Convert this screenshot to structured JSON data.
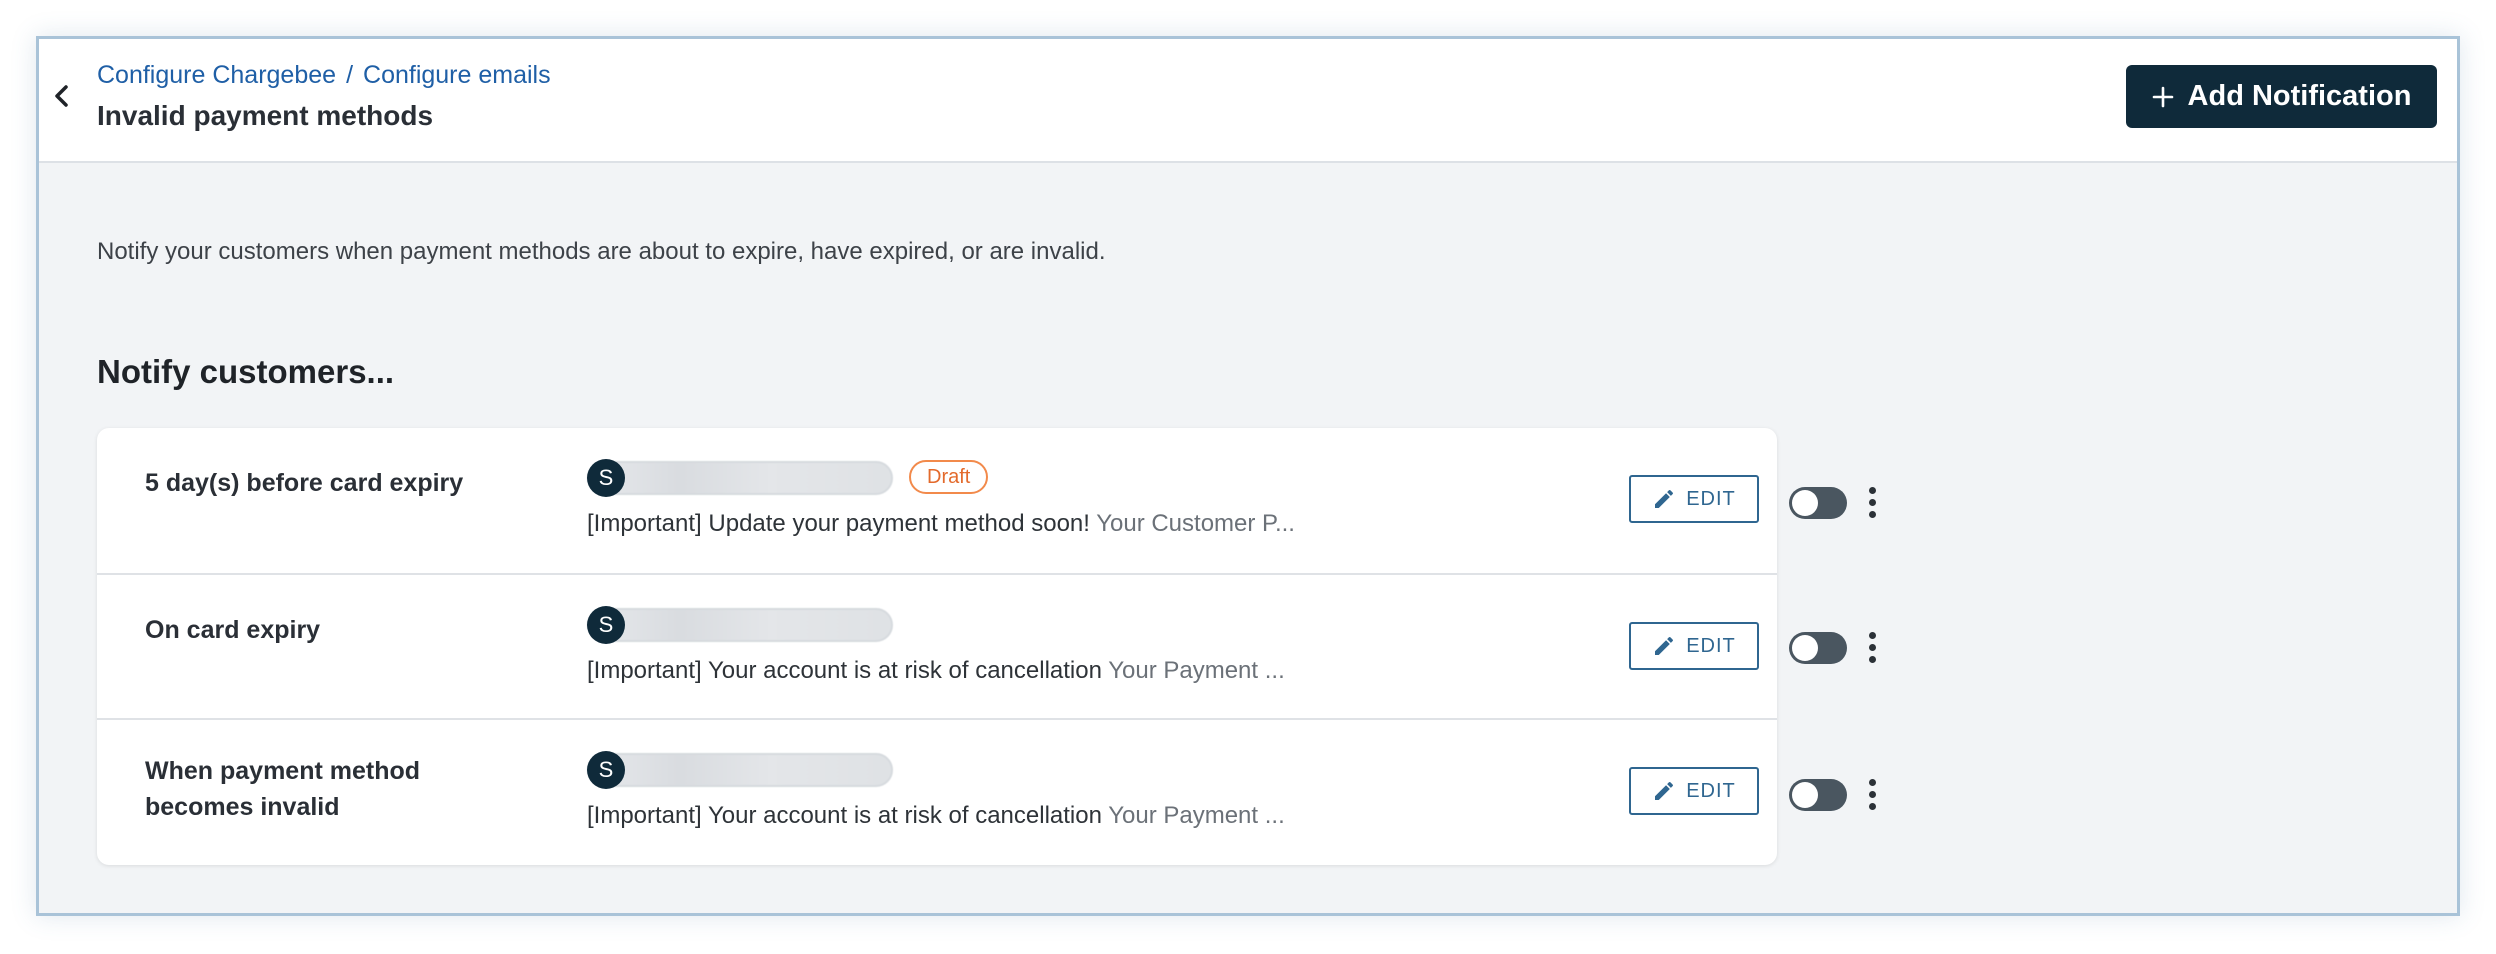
{
  "header": {
    "breadcrumb": [
      "Configure Chargebee",
      "Configure emails"
    ],
    "breadcrumb_separator": "/",
    "title": "Invalid payment methods",
    "add_button_label": "Add Notification",
    "add_button_icon": "plus-icon",
    "back_icon": "chevron-left-icon"
  },
  "main": {
    "description": "Notify your customers when payment methods are about to expire, have expired, or are invalid.",
    "section_title": "Notify customers...",
    "notifications": [
      {
        "label": "5 day(s) before card expiry",
        "sender_initial": "S",
        "badge": "Draft",
        "subject": "[Important] Update your payment method soon!",
        "preview": "Your Customer P...",
        "edit_label": "EDIT",
        "enabled": false
      },
      {
        "label": "On card expiry",
        "sender_initial": "S",
        "badge": "",
        "subject": "[Important] Your account is at risk of cancellation",
        "preview": "Your Payment ...",
        "edit_label": "EDIT",
        "enabled": false
      },
      {
        "label": "When payment method becomes invalid",
        "sender_initial": "S",
        "badge": "",
        "subject": "[Important] Your account is at risk of cancellation",
        "preview": "Your Payment ...",
        "edit_label": "EDIT",
        "enabled": false
      }
    ]
  },
  "colors": {
    "primary_button": "#0f2a3a",
    "link": "#1f5fa6",
    "draft_badge": "#e36a2c",
    "edit_accent": "#2f6690",
    "toggle_off": "#4a5660",
    "page_background": "#f2f4f6"
  }
}
